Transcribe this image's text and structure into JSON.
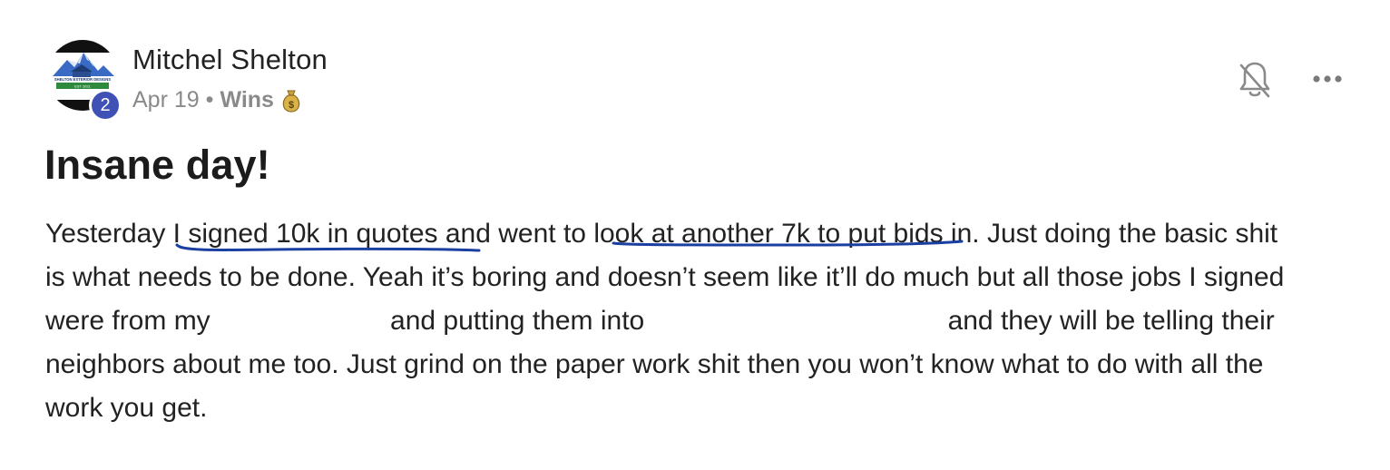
{
  "author": {
    "name": "Mitchel Shelton",
    "level": "2",
    "avatar_logo_text": "SHELTON EXTERIOR DESIGNS",
    "avatar_logo_subtext": "EST 2021"
  },
  "meta": {
    "date": "Apr 19",
    "separator": "•",
    "category": "Wins",
    "category_emoji": "money-bag-icon"
  },
  "post": {
    "title": "Insane day!",
    "body": {
      "line1_a": "Yesterday ",
      "line1_hl1": "I signed 10k in quotes",
      "line1_b": " and went to ",
      "line1_hl2": "look at another 7k to put bids",
      "line1_c": " in. Just doing the basic shit",
      "line2": "is what needs to be done. Yeah it’s boring and doesn’t seem like it’ll do much but all those jobs I signed",
      "line3_a": "were from my ",
      "line3_b": "and putting them into ",
      "line3_c": "and they will be telling their",
      "line4": "neighbors about me too. Just grind on the paper work shit then you won’t know what to do with all the",
      "line5": "work you get."
    }
  },
  "colors": {
    "badge": "#3f51b5",
    "underline": "#1a3fa0",
    "meta_text": "#8a8a8a"
  }
}
